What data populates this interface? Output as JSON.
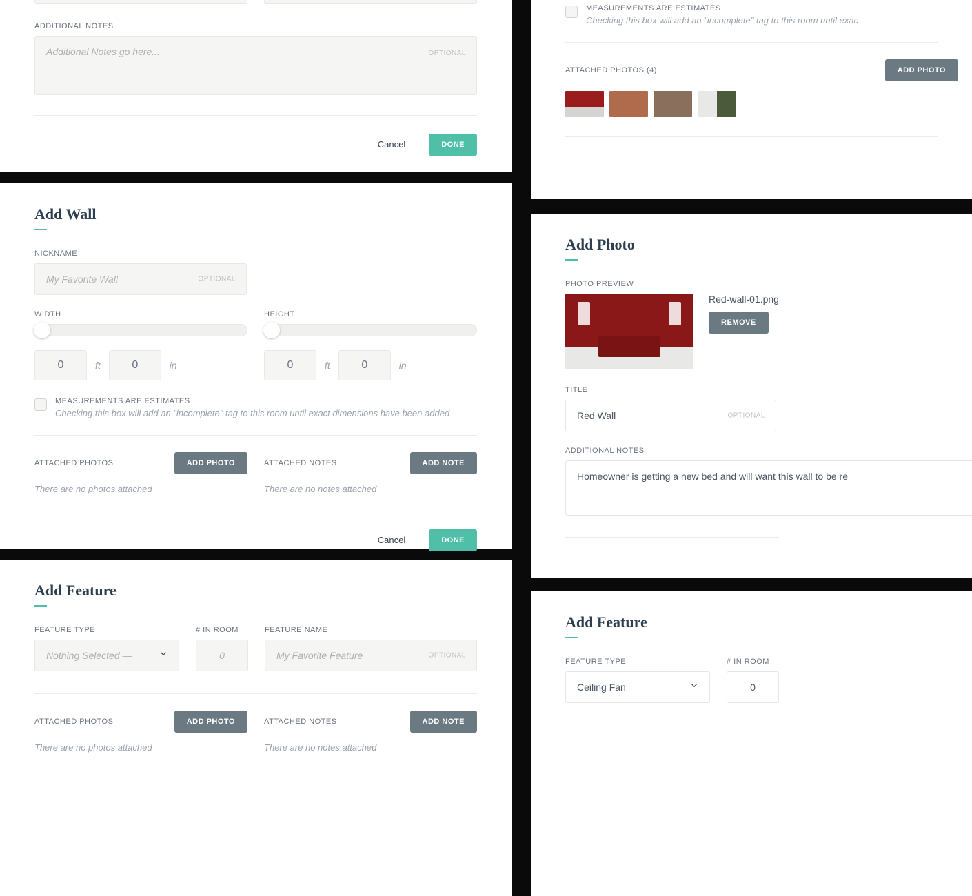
{
  "common": {
    "optional": "OPTIONAL",
    "cancel": "Cancel",
    "done": "DONE",
    "add_photo": "ADD PHOTO",
    "add_note": "ADD NOTE",
    "remove": "REMOVE",
    "ft": "ft",
    "in": "in"
  },
  "panel1": {
    "additional_notes_label": "ADDITIONAL NOTES",
    "additional_notes_placeholder": "Additional Notes go here..."
  },
  "panel2": {
    "estimates_label": "MEASUREMENTS ARE ESTIMATES",
    "estimates_sub": "Checking this box will add an \"incomplete\" tag to this room until exac",
    "attached_photos_label": "ATTACHED PHOTOS (4)"
  },
  "add_wall": {
    "title": "Add Wall",
    "nickname_label": "NICKNAME",
    "nickname_placeholder": "My Favorite Wall",
    "width_label": "WIDTH",
    "height_label": "HEIGHT",
    "width_ft": "0",
    "width_in": "0",
    "height_ft": "0",
    "height_in": "0",
    "estimates_label": "MEASUREMENTS ARE ESTIMATES",
    "estimates_sub": "Checking this box will add an \"incomplete\" tag to this room until exact dimensions have been added",
    "attached_photos_label": "ATTACHED PHOTOS",
    "no_photos": "There are no photos attached",
    "attached_notes_label": "ATTACHED NOTES",
    "no_notes": "There are no notes attached"
  },
  "add_photo": {
    "title": "Add Photo",
    "preview_label": "PHOTO PREVIEW",
    "filename": "Red-wall-01.png",
    "title_label": "TITLE",
    "title_value": "Red Wall",
    "notes_label": "ADDITIONAL NOTES",
    "notes_value": "Homeowner is getting a new bed and will want this wall to be re"
  },
  "add_feature_left": {
    "title": "Add Feature",
    "type_label": "FEATURE TYPE",
    "type_placeholder": "Nothing Selected —",
    "count_label": "# IN ROOM",
    "count_value": "0",
    "name_label": "FEATURE NAME",
    "name_placeholder": "My Favorite Feature",
    "attached_photos_label": "ATTACHED PHOTOS",
    "no_photos": "There are no photos attached",
    "attached_notes_label": "ATTACHED NOTES",
    "no_notes": "There are no notes attached"
  },
  "add_feature_right": {
    "title": "Add Feature",
    "type_label": "FEATURE TYPE",
    "type_value": "Ceiling Fan",
    "count_label": "# IN ROOM",
    "count_value": "0"
  }
}
